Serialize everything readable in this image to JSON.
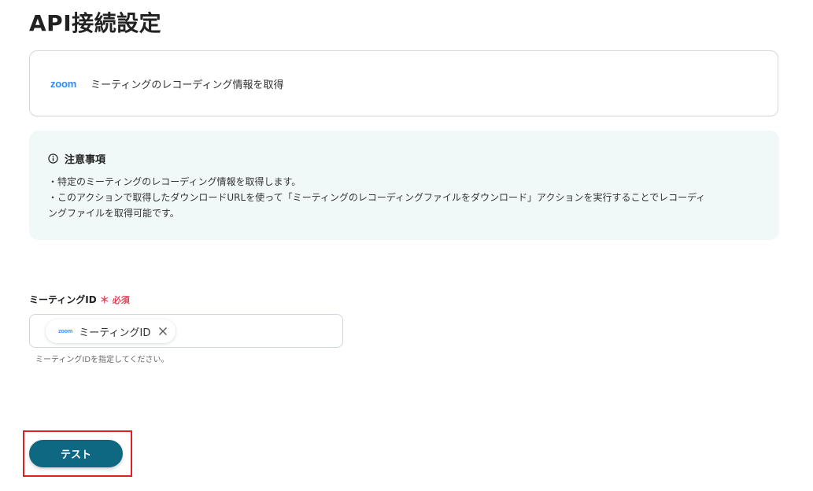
{
  "page": {
    "title": "API接続設定"
  },
  "action": {
    "app_logo_text": "zoom",
    "label": "ミーティングのレコーディング情報を取得"
  },
  "notice": {
    "title": "注意事項",
    "lines": [
      "・特定のミーティングのレコーディング情報を取得します。",
      "・このアクションで取得したダウンロードURLを使って「ミーティングのレコーディングファイルをダウンロード」アクションを実行することでレコーディ",
      "ングファイルを取得可能です。"
    ]
  },
  "field": {
    "label": "ミーティングID",
    "required_mark": "＊",
    "required_text": "必須",
    "chip_logo_text": "zoom",
    "chip_label": "ミーティングID",
    "help": "ミーティングIDを指定してください。"
  },
  "buttons": {
    "test_label": "テスト"
  },
  "colors": {
    "accent": "#0e6882",
    "zoom_blue": "#2d8cff",
    "required": "#e0455a",
    "notice_bg": "#f1f8f8",
    "highlight": "#e02020"
  }
}
